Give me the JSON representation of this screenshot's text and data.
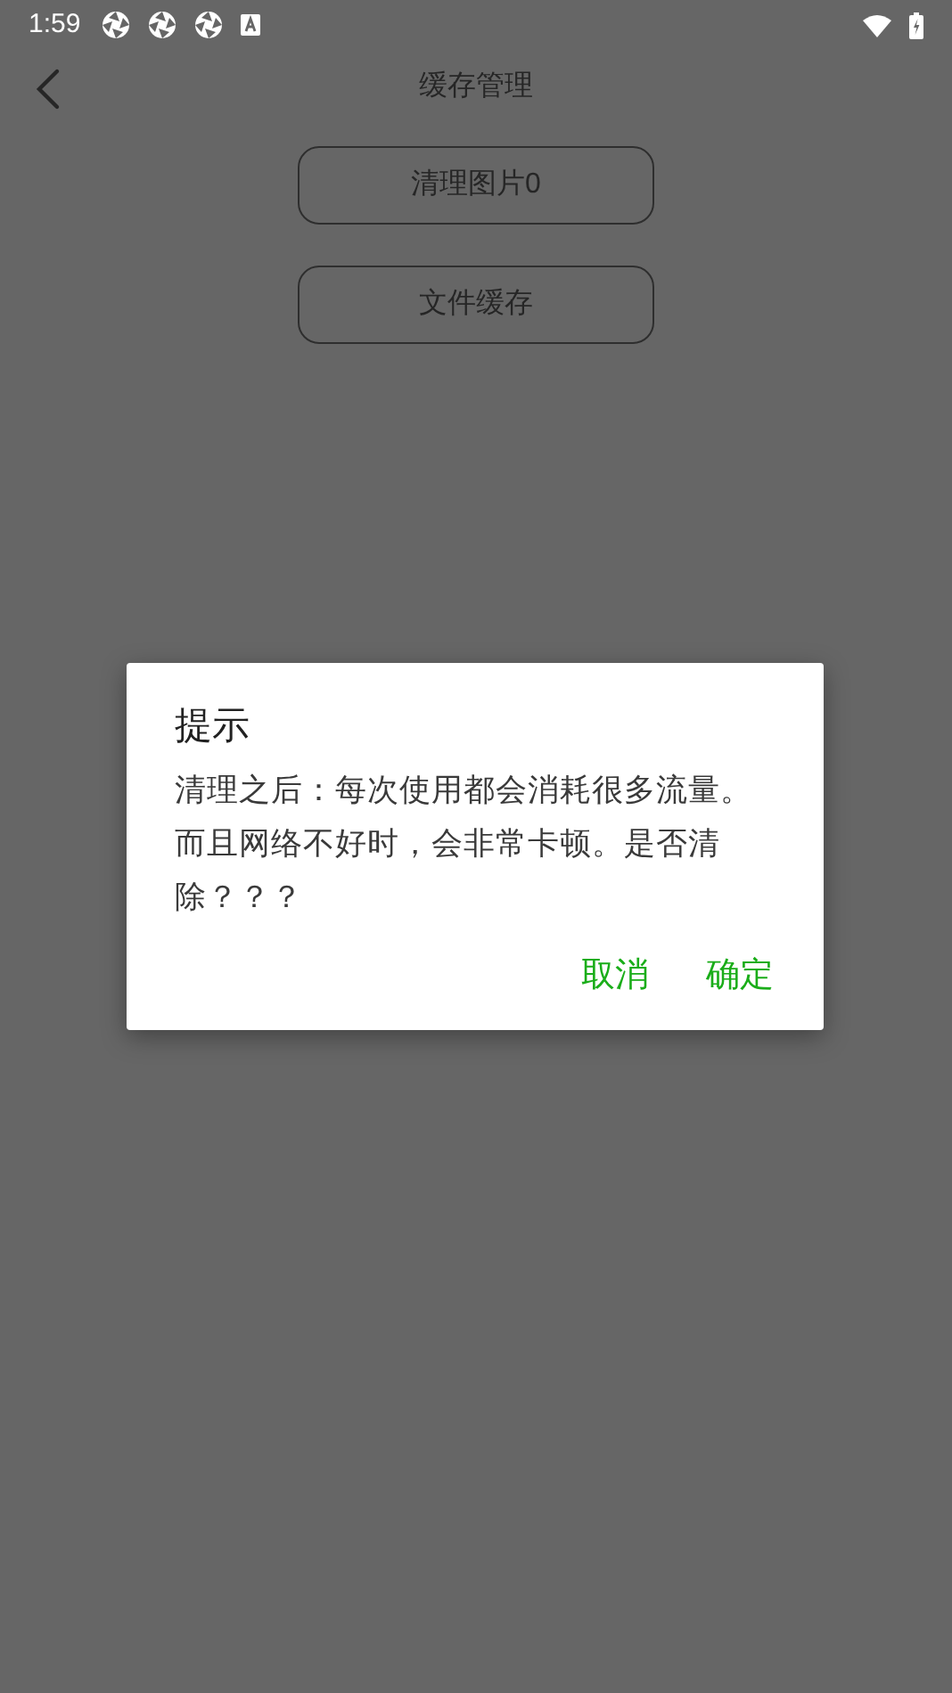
{
  "status_bar": {
    "time": "1:59"
  },
  "header": {
    "title": "缓存管理"
  },
  "buttons": [
    "清理图片0",
    "文件缓存"
  ],
  "dialog": {
    "title": "提示",
    "message": "清理之后：每次使用都会消耗很多流量。而且网络不好时，会非常卡顿。是否清除？？？",
    "actions": [
      "取消",
      "确定"
    ]
  }
}
